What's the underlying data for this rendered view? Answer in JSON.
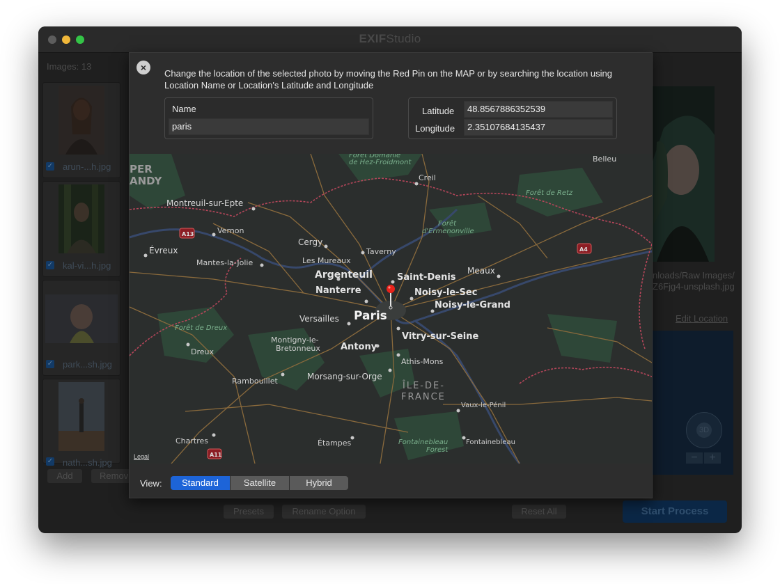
{
  "window": {
    "title_bold": "EXIF",
    "title_rest": "Studio",
    "images_count_label": "Images: 13"
  },
  "sidebar": {
    "files": [
      {
        "name": "arun-...h.jpg"
      },
      {
        "name": "kal-vi...h.jpg"
      },
      {
        "name": "park...sh.jpg"
      },
      {
        "name": "nath...sh.jpg"
      }
    ],
    "add_label": "Add",
    "remove_label": "Remov"
  },
  "preview": {
    "path_line1": "nloads/Raw Images/",
    "path_line2": "Z6Fjg4-unsplash.jpg",
    "edit_location_label": "Edit Location",
    "compass_label": "3D"
  },
  "toolbar": {
    "presets_label": "Presets",
    "rename_label": "Rename Option",
    "reset_label": "Reset All",
    "start_label": "Start Process"
  },
  "dialog": {
    "close_icon": "×",
    "instructions": "Change the location of the selected photo by moving the Red Pin on the MAP or by searching the location using Location Name or Location's Latitude and Longitude",
    "name_label": "Name",
    "name_value": "paris",
    "latitude_label": "Latitude",
    "latitude_value": "48.8567886352539",
    "longitude_label": "Longitude",
    "longitude_value": "2.35107684135437",
    "view_label": "View:",
    "view_options": [
      "Standard",
      "Satellite",
      "Hybrid"
    ],
    "selected_view": "Standard",
    "compass_label": "3D",
    "zoom_out": "−",
    "zoom_in": "+",
    "legal_label": "Legal"
  },
  "map": {
    "labels": {
      "foret_dommane": "Forêt Domanie",
      "hez_froidmont": "de Hez-Froidmont",
      "belleu": "Belleu",
      "per": "PER",
      "andy": "ANDY",
      "creil": "Creil",
      "foret_retz": "Forêt de Retz",
      "montreuil": "Montreuil-sur-Epte",
      "a13": "A13",
      "vernon": "Vernon",
      "foret_ermenonville_1": "Forêt",
      "foret_ermenonville_2": "d'Ermenonville",
      "cergy": "Cergy",
      "evreux": "Évreux",
      "taverny": "Taverny",
      "a4": "A4",
      "mantes": "Mantes-la-Jolie",
      "les_mureaux": "Les Mureaux",
      "argenteuil": "Argenteuil",
      "meaux": "Meaux",
      "saint_denis": "Saint-Denis",
      "nanterre": "Nanterre",
      "noisy_sec": "Noisy-le-Sec",
      "noisy_grand": "Noisy-le-Grand",
      "paris": "Paris",
      "versailles": "Versailles",
      "foret_dreux": "Forêt de Dreux",
      "montigny_1": "Montigny-le-",
      "montigny_2": "Bretonneux",
      "antony": "Antony",
      "vitry": "Vitry-sur-Seine",
      "dreux": "Dreux",
      "athis": "Athis-Mons",
      "rambouillet": "Rambouillet",
      "morsang": "Morsang-sur-Orge",
      "idf_1": "ÎLE-DE-",
      "idf_2": "FRANCE",
      "vaux": "Vaux-le-Pénil",
      "chartres": "Chartres",
      "etampes": "Étampes",
      "fontainebleau_forest_1": "Fontainebleau",
      "fontainebleau_forest_2": "Forest",
      "fontainebleau": "Fontainebleau",
      "a11": "A11"
    }
  },
  "colors": {
    "accent": "#1d64d8",
    "pin": "#e8231b",
    "map_background": "#2b2e2d",
    "forest": "#2f4a3a",
    "water": "#37486b",
    "border": "#b5465a",
    "road": "#8a6a3c"
  }
}
